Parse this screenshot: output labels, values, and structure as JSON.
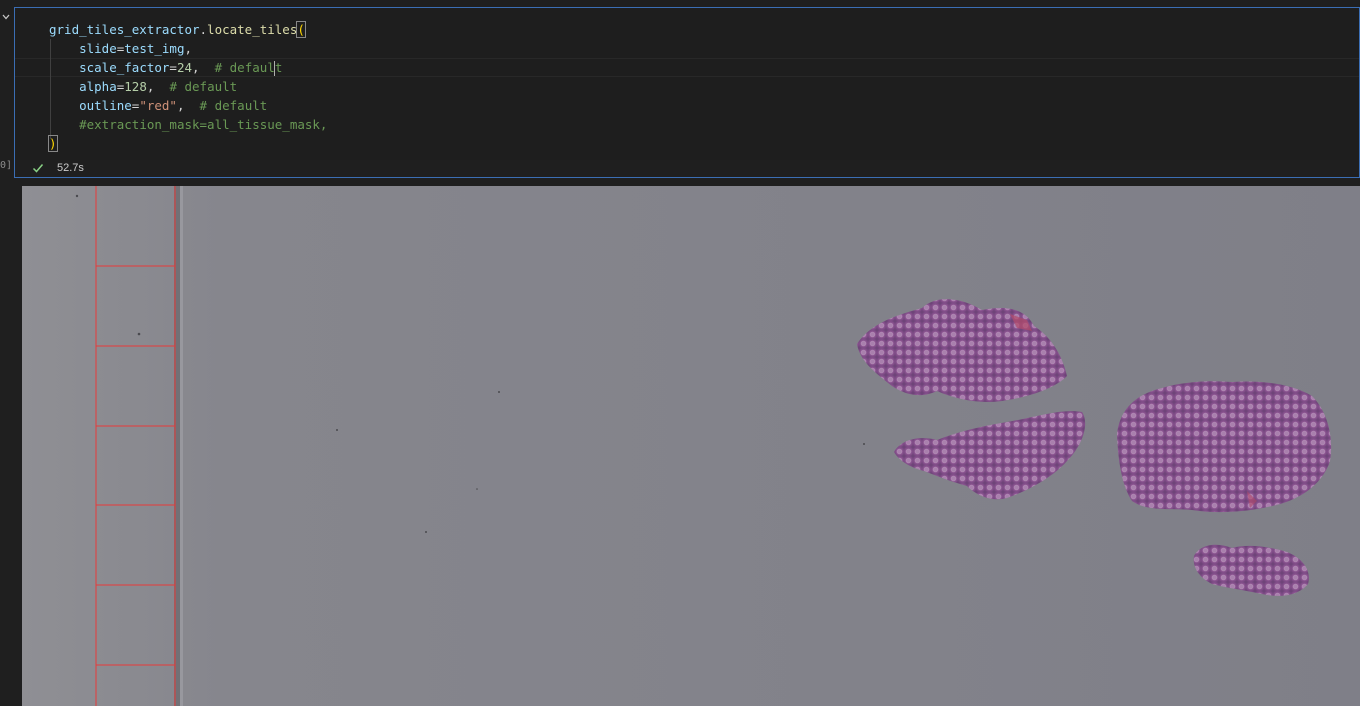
{
  "cell": {
    "execution_label": "0]",
    "status_time": "52.7s",
    "status_icon": "check-icon",
    "code_lines": {
      "l1": {
        "obj": "grid_tiles_extractor",
        "dot": ".",
        "fn": "locate_tiles",
        "paren": "("
      },
      "l2": {
        "name": "slide",
        "eq": "=",
        "value": "test_img",
        "comma": ","
      },
      "l3": {
        "name": "scale_factor",
        "eq": "=",
        "value": "24",
        "comma": ",",
        "comment_a": "  # defaul",
        "comment_b": "t"
      },
      "l4": {
        "name": "alpha",
        "eq": "=",
        "value": "128",
        "comma": ",",
        "comment": "  # default"
      },
      "l5": {
        "name": "outline",
        "eq": "=",
        "value": "\"red\"",
        "comma": ",",
        "comment": "  # default"
      },
      "l6": {
        "comment": "#extraction_mask=all_tissue_mask,"
      },
      "l7": {
        "paren": ")"
      }
    }
  },
  "output": {
    "image_description_name": "slide-thumbnail-with-tile-grid",
    "background_color": "#808087",
    "grid_outline_color": "#ff0000",
    "tissue_color": "#8a4f8f"
  }
}
